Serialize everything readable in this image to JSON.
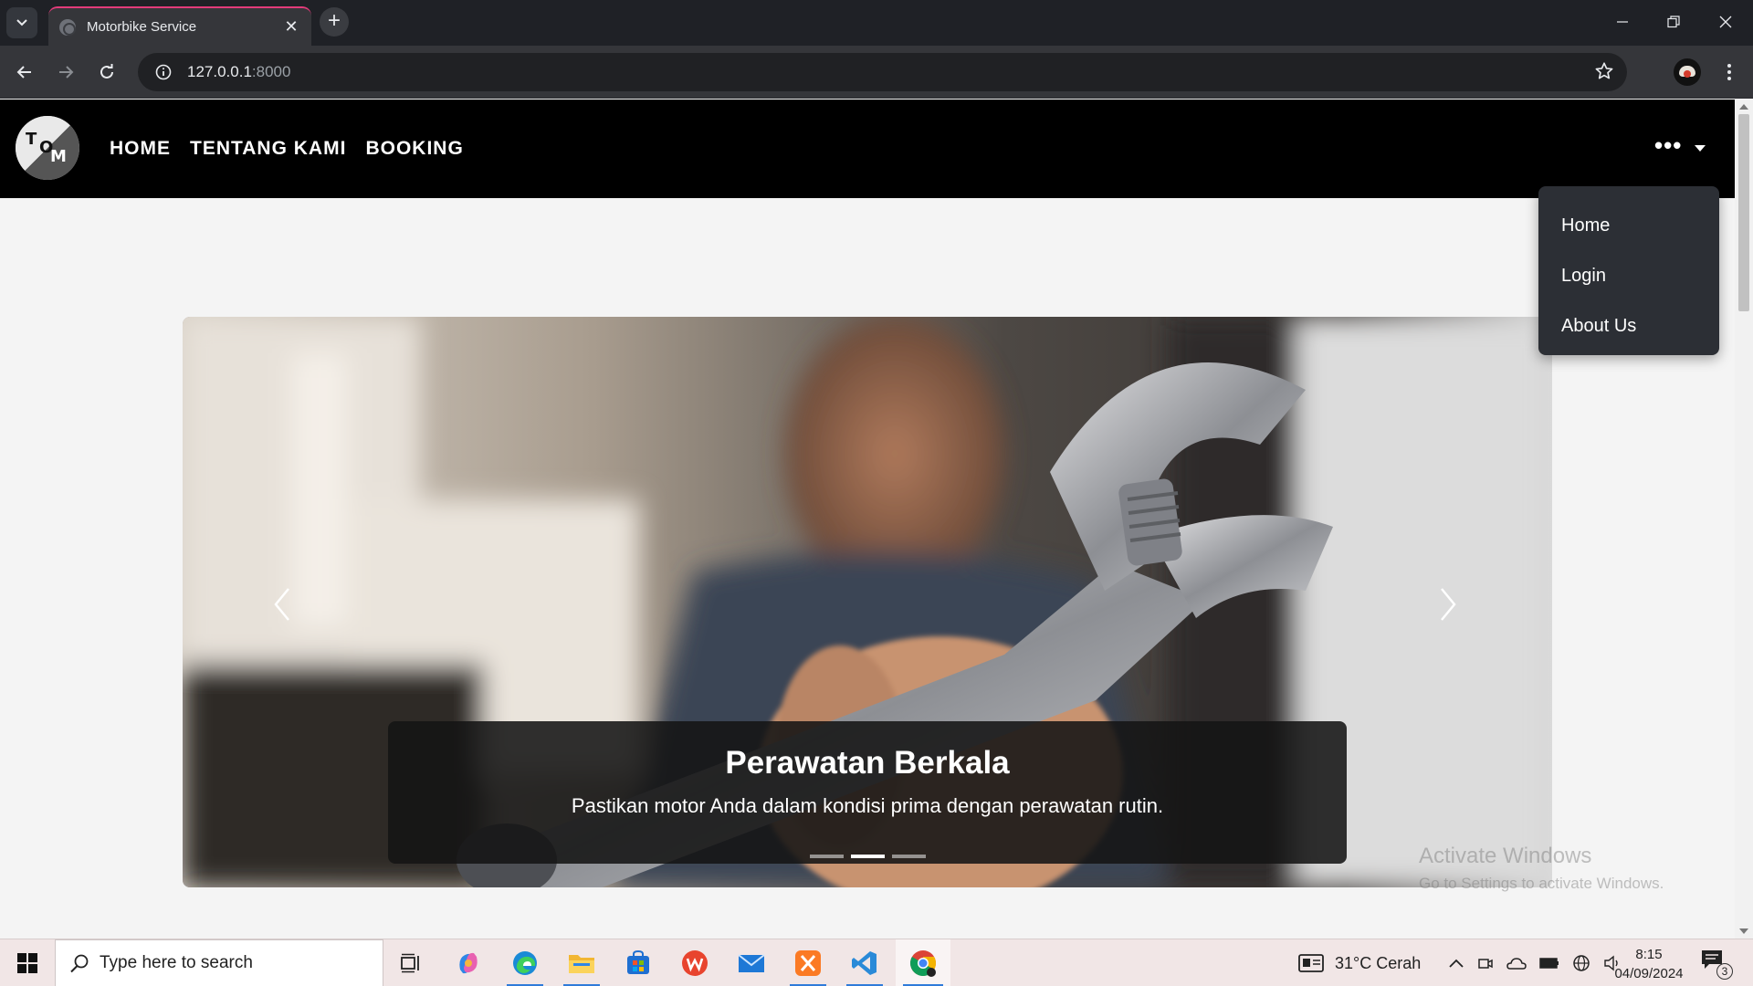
{
  "browser": {
    "tab_title": "Motorbike Service",
    "url_host": "127.0.0.1",
    "url_port": ":8000"
  },
  "site": {
    "logo_letters": [
      "T",
      "O",
      "M"
    ],
    "nav": [
      "HOME",
      "TENTANG KAMI",
      "BOOKING"
    ],
    "more_label": "•••",
    "dropdown": [
      "Home",
      "Login",
      "About Us"
    ]
  },
  "carousel": {
    "title": "Perawatan Berkala",
    "text": "Pastikan motor Anda dalam kondisi prima dengan perawatan rutin.",
    "slide_count": 3,
    "active_slide": 2
  },
  "watermark": {
    "line1": "Activate Windows",
    "line2": "Go to Settings to activate Windows."
  },
  "taskbar": {
    "search_placeholder": "Type here to search",
    "weather": "31°C  Cerah",
    "time": "8:15",
    "date": "04/09/2024",
    "notification_count": "3"
  },
  "colors": {
    "accent_tab": "#e23b7a",
    "navbar": "#000000",
    "dropdown_bg": "#2c2f35"
  }
}
